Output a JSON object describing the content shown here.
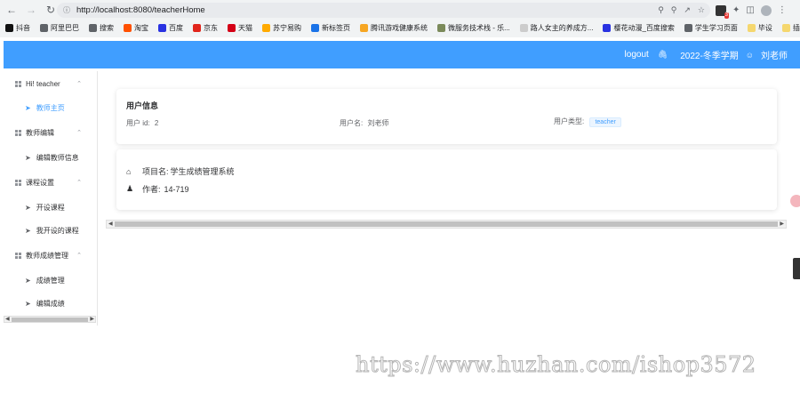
{
  "browser": {
    "url": "http://localhost:8080/teacherHome",
    "bookmarks": [
      {
        "label": "抖音",
        "color": "#111111"
      },
      {
        "label": "阿里巴巴",
        "color": "#5f6368"
      },
      {
        "label": "搜索",
        "color": "#5f6368"
      },
      {
        "label": "淘宝",
        "color": "#ff5000"
      },
      {
        "label": "百度",
        "color": "#2932e1"
      },
      {
        "label": "京东",
        "color": "#e1251b"
      },
      {
        "label": "天猫",
        "color": "#d40016"
      },
      {
        "label": "苏宁易购",
        "color": "#ffaa00"
      },
      {
        "label": "新标签页",
        "color": "#1a73e8"
      },
      {
        "label": "腾讯游戏健康系统",
        "color": "#f6a623"
      },
      {
        "label": "微服务技术栈 - 乐...",
        "color": "#7b8a5a"
      },
      {
        "label": "路人女主的养成方...",
        "color": "#cccccc"
      },
      {
        "label": "樱花动漫_百度搜索",
        "color": "#2932e1"
      },
      {
        "label": "学生学习页面",
        "color": "#5f6368"
      },
      {
        "label": "毕设",
        "color": "#f5d76e"
      },
      {
        "label": "插建",
        "color": "#f5d76e"
      }
    ],
    "extension_badge": "3"
  },
  "header": {
    "logout": "logout",
    "term": "2022-冬季学期",
    "user": "刘老师",
    "color": "#409eff"
  },
  "sidebar": {
    "groups": [
      {
        "title": "Hi! teacher",
        "items": [
          "教师主页"
        ]
      },
      {
        "title": "教师编辑",
        "items": [
          "编辑教师信息"
        ]
      },
      {
        "title": "课程设置",
        "items": [
          "开设课程",
          "我开设的课程"
        ]
      },
      {
        "title": "教师成绩管理",
        "items": [
          "成绩管理",
          "编辑成绩"
        ]
      }
    ],
    "active_item": "教师主页"
  },
  "user_info": {
    "title": "用户信息",
    "id_label": "用户 id:",
    "id_value": "2",
    "name_label": "用户名:",
    "name_value": "刘老师",
    "type_label": "用户类型:",
    "type_value": "teacher"
  },
  "project": {
    "name_label": "项目名:",
    "name_value": "学生成绩管理系统",
    "author_label": "作者:",
    "author_value": "14-719"
  },
  "watermark": "https://www.huzhan.com/ishop3572"
}
